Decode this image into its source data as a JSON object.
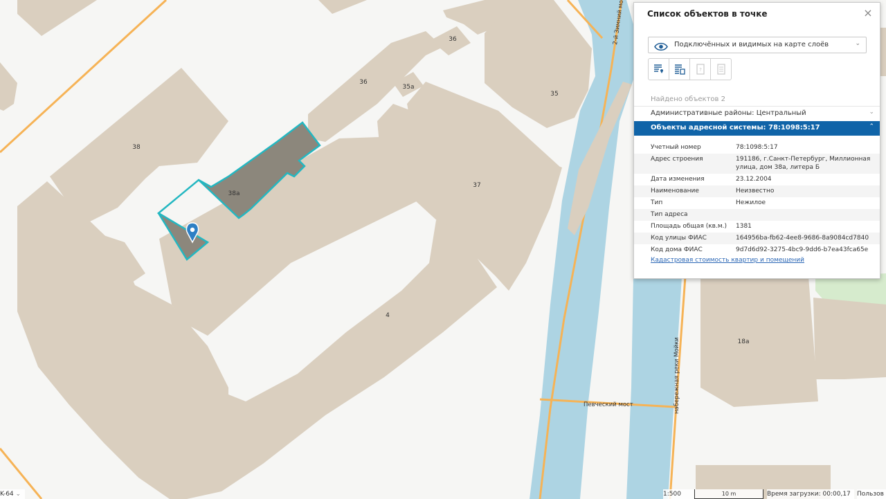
{
  "map": {
    "building_labels": {
      "b38": "38",
      "b38a": "38а",
      "b36_top": "36",
      "b36": "36",
      "b35a": "35а",
      "b35": "35",
      "b37": "37",
      "b4": "4",
      "b18a": "18а"
    },
    "street_labels": {
      "zimny": "2-й Зимний мост",
      "pevchesky": "Певческий мост",
      "moyka": "набережная реки Мойки"
    },
    "colors": {
      "background": "#f6f6f4",
      "building": "#dacfbf",
      "selected_building": "#8c877c",
      "selected_outline": "#23b7c1",
      "road": "#f6b356",
      "water": "#add4e3",
      "park": "#d6ebcd",
      "marker": "#2d7fc4"
    }
  },
  "panel": {
    "title": "Список объектов в точке",
    "close_icon": "close-icon",
    "layer_select": {
      "value": "Подключённых и видимых на карте слоёв",
      "icon": "eye-icon"
    },
    "toolbar_icons": [
      "list-pin-icon",
      "list-building-icon",
      "document-question-icon",
      "document-icon"
    ],
    "found": "Найдено объектов 2",
    "sections": [
      {
        "title": "Административные районы: Центральный",
        "expanded": false
      },
      {
        "title": "Объекты адресной системы: 78:1098:5:17",
        "expanded": true
      }
    ],
    "attributes": [
      {
        "key": "Учетный номер",
        "value": "78:1098:5:17"
      },
      {
        "key": "Адрес строения",
        "value": "191186, г.Санкт-Петербург, Миллионная улица, дом 38а, литера Б"
      },
      {
        "key": "Дата изменения",
        "value": "23.12.2004"
      },
      {
        "key": "Наименование",
        "value": "Неизвестно"
      },
      {
        "key": "Тип",
        "value": "Нежилое"
      },
      {
        "key": "Тип адреса",
        "value": ""
      },
      {
        "key": "Площадь общая (кв.м.)",
        "value": "1381"
      },
      {
        "key": "Код улицы ФИАС",
        "value": "164956ba-fb62-4ee8-9686-8a9084cd7840"
      },
      {
        "key": "Код дома ФИАС",
        "value": "9d7d6d92-3275-4bc9-9dd6-b7ea43fca65e"
      }
    ],
    "link": "Кадастровая стоимость квартир и помещений"
  },
  "statusbar": {
    "crs": "K-64",
    "scale": "1:500",
    "scale_bar": "10 m",
    "load_time": "Время загрузки: 00:00,17",
    "user": "Пользов"
  }
}
